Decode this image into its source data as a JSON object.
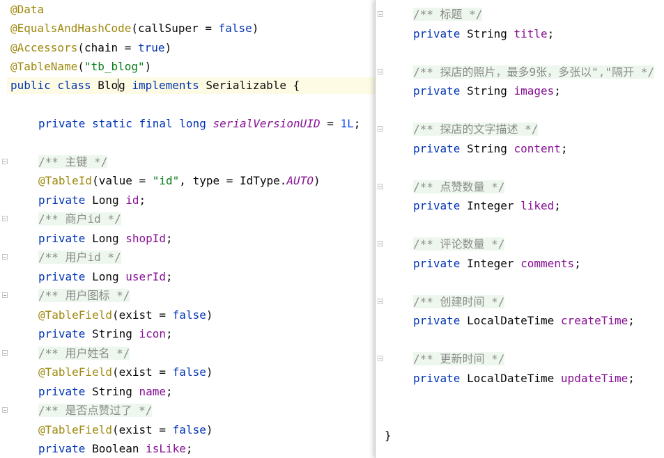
{
  "left": {
    "l1": "@Data",
    "l2a": "@EqualsAndHashCode",
    "l2b": "(callSuper = ",
    "l2c": "false",
    "l2d": ")",
    "l3a": "@Accessors",
    "l3b": "(chain = ",
    "l3c": "true",
    "l3d": ")",
    "l4a": "@TableName",
    "l4b": "(",
    "l4c": "\"tb_blog\"",
    "l4d": ")",
    "l5a": "public class ",
    "l5b": "Blo",
    "l5c": "g",
    "l5d": " implements ",
    "l5e": "Serializable {",
    "l6a": "private static final long ",
    "l6b": "serialVersionUID",
    "l6c": " = ",
    "l6d": "1L",
    "l6e": ";",
    "c1": "/** 主键 */",
    "l7a": "@TableId",
    "l7b": "(value = ",
    "l7c": "\"id\"",
    "l7d": ", type = IdType.",
    "l7e": "AUTO",
    "l7f": ")",
    "l8a": "private ",
    "l8b": "Long ",
    "l8c": "id",
    "l8d": ";",
    "c2": "/** 商户id */",
    "l9a": "private ",
    "l9b": "Long ",
    "l9c": "shopId",
    "l9d": ";",
    "c3": "/** 用户id */",
    "l10a": "private ",
    "l10b": "Long ",
    "l10c": "userId",
    "l10d": ";",
    "c4": "/** 用户图标 */",
    "l11a": "@TableField",
    "l11b": "(exist = ",
    "l11c": "false",
    "l11d": ")",
    "l12a": "private ",
    "l12b": "String ",
    "l12c": "icon",
    "l12d": ";",
    "c5": "/** 用户姓名 */",
    "l13a": "@TableField",
    "l13b": "(exist = ",
    "l13c": "false",
    "l13d": ")",
    "l14a": "private ",
    "l14b": "String ",
    "l14c": "name",
    "l14d": ";",
    "c6": "/** 是否点赞过了 */",
    "l15a": "@TableField",
    "l15b": "(exist = ",
    "l15c": "false",
    "l15d": ")",
    "l16a": "private ",
    "l16b": "Boolean ",
    "l16c": "isLike",
    "l16d": ";"
  },
  "right": {
    "c1": "/** 标题 */",
    "r1a": "private ",
    "r1b": "String ",
    "r1c": "title",
    "r1d": ";",
    "c2": "/** 探店的照片，最多9张，多张以\",\"隔开 */",
    "r2a": "private ",
    "r2b": "String ",
    "r2c": "images",
    "r2d": ";",
    "c3": "/** 探店的文字描述 */",
    "r3a": "private ",
    "r3b": "String ",
    "r3c": "content",
    "r3d": ";",
    "c4": "/** 点赞数量 */",
    "r4a": "private ",
    "r4b": "Integer ",
    "r4c": "liked",
    "r4d": ";",
    "c5": "/** 评论数量 */",
    "r5a": "private ",
    "r5b": "Integer ",
    "r5c": "comments",
    "r5d": ";",
    "c6": "/** 创建时间 */",
    "r6a": "private ",
    "r6b": "LocalDateTime ",
    "r6c": "createTime",
    "r6d": ";",
    "c7": "/** 更新时间 */",
    "r7a": "private ",
    "r7b": "LocalDateTime ",
    "r7c": "updateTime",
    "r7d": ";",
    "close": "}"
  }
}
